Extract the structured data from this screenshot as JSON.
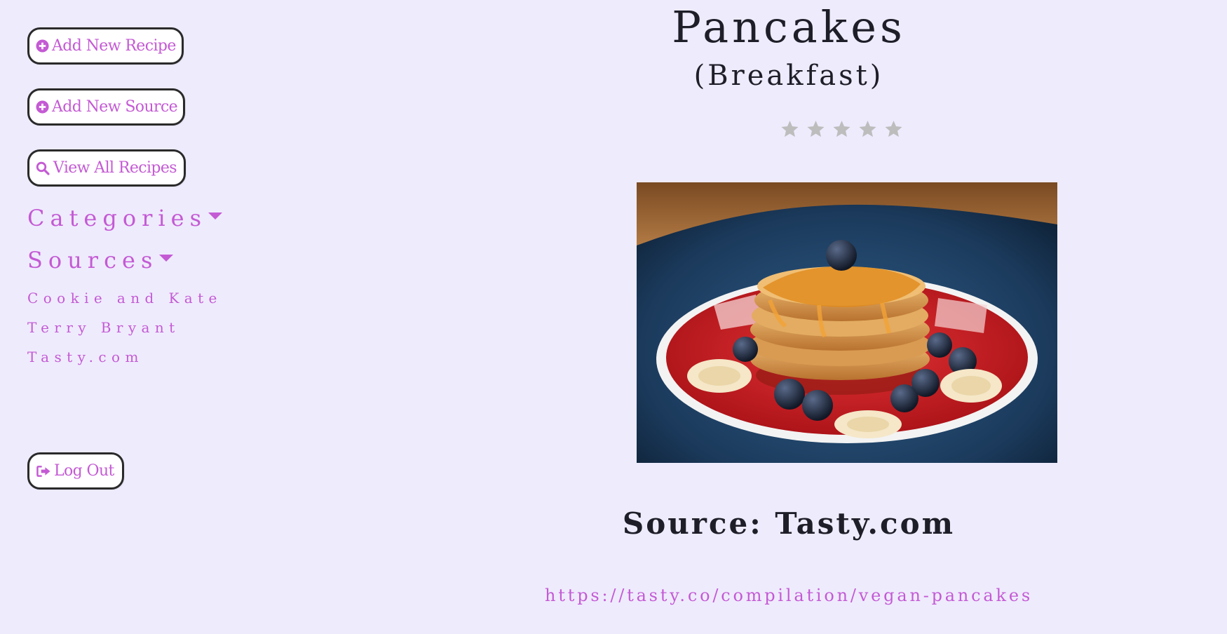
{
  "colors": {
    "background": "#eeebfd",
    "accent": "#c45ad4",
    "text": "#1e1e28",
    "star_empty": "#bdbdbd",
    "button_border": "#2a2a2a"
  },
  "sidebar": {
    "add_recipe_label": "Add New Recipe",
    "add_source_label": "Add New Source",
    "view_all_label": "View All Recipes",
    "categories_label": "Categories",
    "sources_label": "Sources",
    "sources_items": [
      "Cookie and Kate",
      "Terry Bryant",
      "Tasty.com"
    ],
    "logout_label": "Log Out",
    "icons": {
      "add_recipe": "plus-circle-icon",
      "add_source": "plus-circle-icon",
      "view_all": "search-icon",
      "logout": "sign-out-icon",
      "dropdown": "caret-down-icon"
    }
  },
  "recipe": {
    "title": "Pancakes",
    "category": "(Breakfast)",
    "rating": {
      "value": 0,
      "max": 5
    },
    "image": "photo of stacked pancakes with syrup, blueberries and banana slices on a red plate",
    "source_line": "Source: Tasty.com",
    "url": "https://tasty.co/compilation/vegan-pancakes"
  }
}
